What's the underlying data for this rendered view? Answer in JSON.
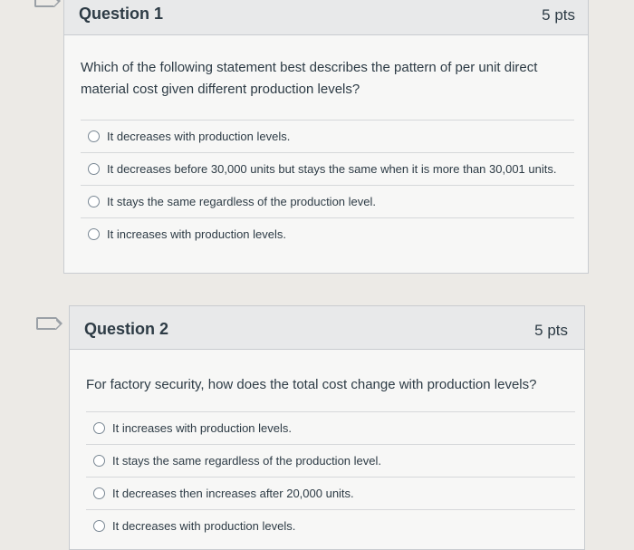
{
  "questions": [
    {
      "title": "Question 1",
      "points": "5 pts",
      "text": "Which of the following statement best describes the pattern of per unit direct material cost given different production levels?",
      "answers": [
        "It decreases with production levels.",
        "It decreases before 30,000 units but stays the same when it is more than 30,001 units.",
        "It stays the same regardless of the production level.",
        "It increases with production levels."
      ]
    },
    {
      "title": "Question 2",
      "points": "5 pts",
      "text": "For factory security, how does the total cost change with production levels?",
      "answers": [
        "It increases with production levels.",
        "It stays the same regardless of the production level.",
        "It decreases then increases after 20,000 units.",
        "It decreases with production levels."
      ]
    }
  ]
}
